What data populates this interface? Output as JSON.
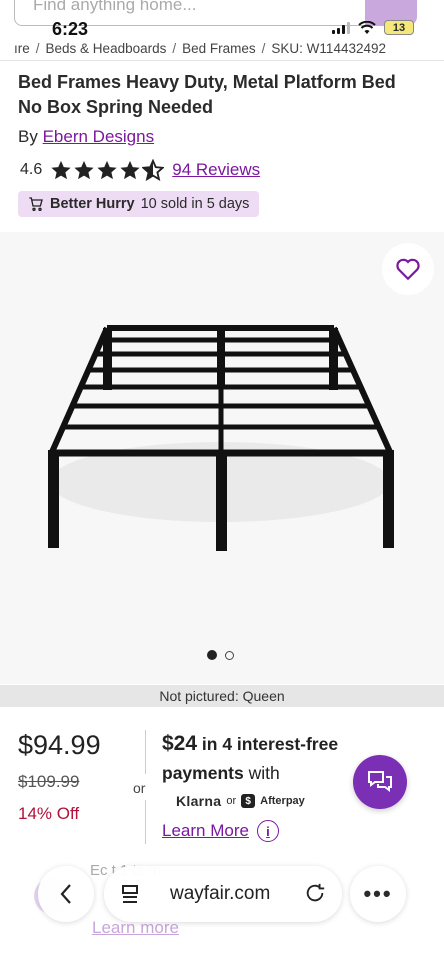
{
  "search": {
    "placeholder": "Find anything home..."
  },
  "status_bar": {
    "time": "6:23",
    "battery": "13"
  },
  "breadcrumb": {
    "items": [
      "ıre",
      "Beds & Headboards",
      "Bed Frames"
    ],
    "sku": "SKU: W114432492"
  },
  "product": {
    "title": "Bed Frames Heavy Duty, Metal Platform Bed No Box Spring Needed",
    "by_label": "By",
    "brand": "Ebern Designs",
    "rating": "4.6",
    "stars_filled": 4.6,
    "reviews": "94 Reviews",
    "hurry_label": "Better Hurry",
    "hurry_text": "10 sold in 5 days"
  },
  "gallery": {
    "image_count": 2,
    "active_index": 0,
    "not_pictured": "Not pictured: Queen"
  },
  "pricing": {
    "price": "$94.99",
    "old_price": "$109.99",
    "percent_off": "14% Off",
    "or_label": "or",
    "installment_amount": "$24",
    "installment_text": "in 4 interest-free payments",
    "installment_with": "with",
    "klarna": "Klarna",
    "provider_or": "or",
    "afterpay_badge": "$",
    "afterpay": "Afterpay",
    "learn_more": "Learn More"
  },
  "behind_content": {
    "text": "Ec          t   1         ts m",
    "link": "Learn more"
  },
  "browser": {
    "url": "wayfair.com",
    "more": "•••"
  },
  "colors": {
    "accent": "#7b189f",
    "chat": "#7b2fb5",
    "hurry_bg": "#eddcf3",
    "sale_red": "#b1123b"
  }
}
